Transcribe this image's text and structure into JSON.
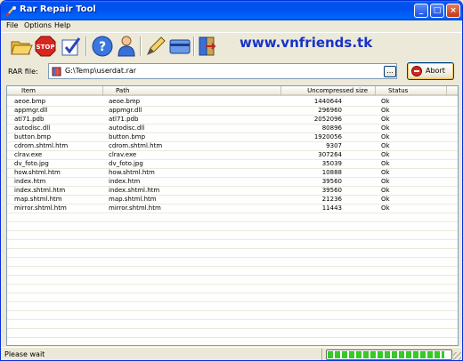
{
  "window": {
    "title": "Rar Repair Tool",
    "controls": [
      "_",
      "□",
      "×"
    ]
  },
  "menu": [
    "File",
    "Options",
    "Help"
  ],
  "toolbar": {
    "icons": [
      "open-folder-icon",
      "stop-icon",
      "check-icon",
      "help-icon",
      "user-icon",
      "edit-icon",
      "card-icon",
      "exit-icon"
    ],
    "brand_text": "www.vnfriends.tk",
    "brand_color": "#1733c8"
  },
  "rar": {
    "label": "RAR file:",
    "value": "G:\\Temp\\userdat.rar",
    "browse_label": "...",
    "abort_label": "Abort"
  },
  "table": {
    "columns": [
      "Item",
      "Path",
      "Uncompressed size",
      "Status"
    ],
    "rows": [
      {
        "item": "aeoe.bmp",
        "path": "aeoe.bmp",
        "size": "1440644",
        "status": "Ok"
      },
      {
        "item": "appmgr.dll",
        "path": "appmgr.dll",
        "size": "296960",
        "status": "Ok"
      },
      {
        "item": "atl71.pdb",
        "path": "atl71.pdb",
        "size": "2052096",
        "status": "Ok"
      },
      {
        "item": "autodisc.dll",
        "path": "autodisc.dll",
        "size": "80896",
        "status": "Ok"
      },
      {
        "item": "button.bmp",
        "path": "button.bmp",
        "size": "1920056",
        "status": "Ok"
      },
      {
        "item": "cdrom.shtml.htm",
        "path": "cdrom.shtml.htm",
        "size": "9307",
        "status": "Ok"
      },
      {
        "item": "clrav.exe",
        "path": "clrav.exe",
        "size": "307264",
        "status": "Ok"
      },
      {
        "item": "dv_foto.jpg",
        "path": "dv_foto.jpg",
        "size": "35039",
        "status": "Ok"
      },
      {
        "item": "how.shtml.htm",
        "path": "how.shtml.htm",
        "size": "10888",
        "status": "Ok"
      },
      {
        "item": "index.htm",
        "path": "index.htm",
        "size": "39560",
        "status": "Ok"
      },
      {
        "item": "index.shtml.htm",
        "path": "index.shtml.htm",
        "size": "39560",
        "status": "Ok"
      },
      {
        "item": "map.shtml.htm",
        "path": "map.shtml.htm",
        "size": "21236",
        "status": "Ok"
      },
      {
        "item": "mirror.shtml.htm",
        "path": "mirror.shtml.htm",
        "size": "11443",
        "status": "Ok"
      }
    ]
  },
  "status": {
    "text": "Please wait",
    "progress_fraction": 0.95,
    "progress_color": "#37c82a"
  }
}
